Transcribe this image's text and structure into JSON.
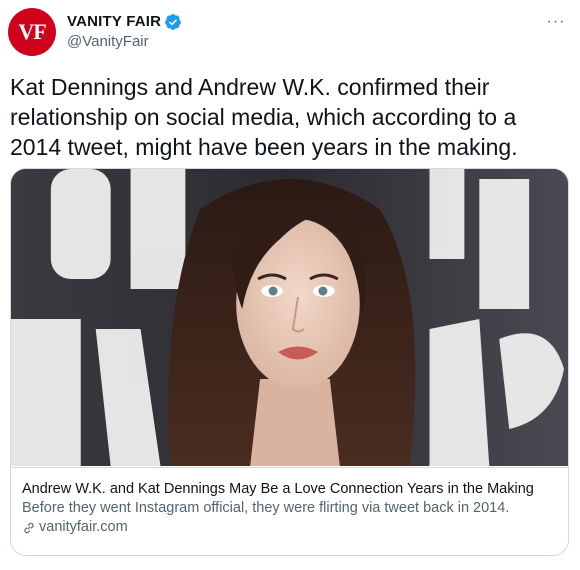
{
  "account": {
    "display_name": "VANITY FAIR",
    "handle": "@VanityFair",
    "avatar_text": "VF",
    "verified": true,
    "avatar_color": "#d0021b",
    "verified_color": "#1d9bf0"
  },
  "more_label": "···",
  "tweet": {
    "text": "Kat Dennings and Andrew W.K. confirmed their relationship on social media, which according to a 2014 tweet, might have been years in the making."
  },
  "card": {
    "title": "Andrew W.K. and Kat Dennings May Be a Love Connection Years in the Making",
    "description": "Before they went Instagram official, they were flirting via tweet back in 2014.",
    "domain": "vanityfair.com",
    "image_icon": "portrait-photo"
  }
}
